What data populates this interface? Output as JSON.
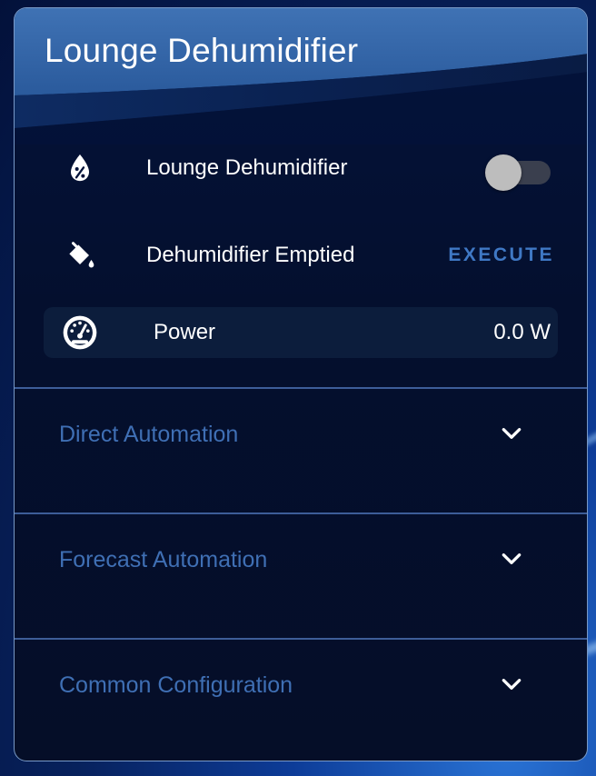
{
  "card": {
    "title": "Lounge Dehumidifier"
  },
  "entities": {
    "switch": {
      "label": "Lounge Dehumidifier",
      "icon": "water-percent-icon",
      "state": "off"
    },
    "emptied": {
      "label": "Dehumidifier Emptied",
      "icon": "paint-bucket-icon",
      "action_label": "EXECUTE"
    },
    "power": {
      "label": "Power",
      "icon": "gauge-icon",
      "value": "0.0 W"
    }
  },
  "sections": [
    {
      "title": "Direct Automation",
      "icon": "chevron-down-icon"
    },
    {
      "title": "Forecast Automation",
      "icon": "chevron-down-icon"
    },
    {
      "title": "Common Configuration",
      "icon": "chevron-down-icon"
    }
  ],
  "colors": {
    "accent": "#3f78c4",
    "section_title": "#3f6fb4",
    "card_bg": "#040f2e",
    "text": "#ffffff"
  }
}
